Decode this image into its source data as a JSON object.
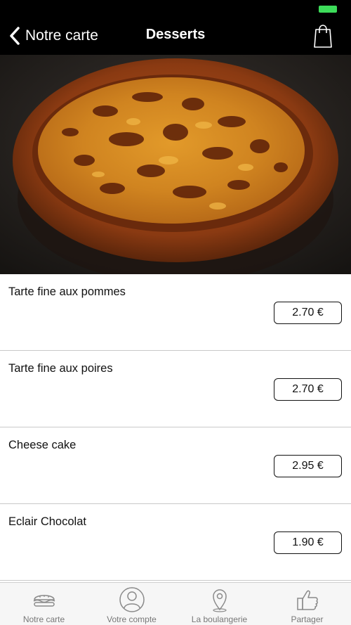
{
  "header": {
    "back_label": "Notre carte",
    "title": "Desserts"
  },
  "items": [
    {
      "name": "Tarte fine aux pommes",
      "price": "2.70 €"
    },
    {
      "name": "Tarte fine aux poires",
      "price": "2.70 €"
    },
    {
      "name": "Cheese cake",
      "price": "2.95 €"
    },
    {
      "name": "Eclair Chocolat",
      "price": "1.90 €"
    }
  ],
  "tabs": [
    {
      "label": "Notre carte",
      "icon": "sandwich-icon"
    },
    {
      "label": "Votre compte",
      "icon": "user-icon"
    },
    {
      "label": "La boulangerie",
      "icon": "location-pin-icon"
    },
    {
      "label": "Partager",
      "icon": "thumbs-up-icon"
    }
  ],
  "colors": {
    "header_bg": "#000000",
    "battery": "#3ddc5a",
    "tab_icon": "#8a8a8a"
  }
}
